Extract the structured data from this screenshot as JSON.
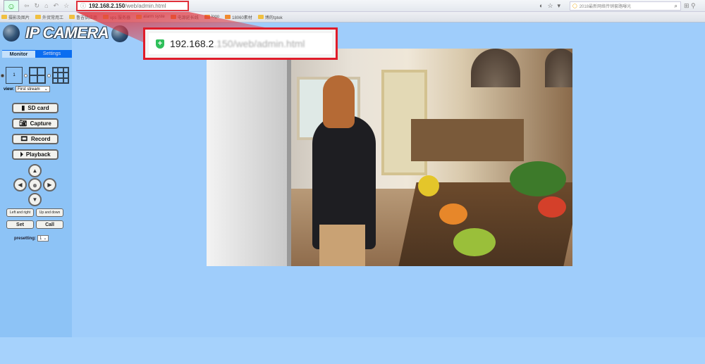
{
  "browser": {
    "url_host": "192.168.2.150",
    "url_path": "/web/admin.html",
    "search_placeholder": "2018最新网络传销套路曝光",
    "bookmarks": [
      {
        "label": "摄影及图片",
        "color": "#f0c040"
      },
      {
        "label": "外贸常用工",
        "color": "#f0c040"
      },
      {
        "label": "鲁吉供应商",
        "color": "#f0c040"
      },
      {
        "label": "vps 服务器",
        "color": "#f0c040"
      },
      {
        "label": "alarm syste",
        "color": "#f0c040"
      },
      {
        "label": "电源延长线",
        "color": "#f08a30"
      },
      {
        "label": "logo",
        "color": "#f08a30"
      },
      {
        "label": "18060素材",
        "color": "#f08a30"
      },
      {
        "label": "博的tptek",
        "color": "#f0c040"
      }
    ]
  },
  "callout": {
    "url_visible": "192.168.2",
    "url_blurred": ".150/web/admin.html",
    "border_color": "#e01c2a"
  },
  "app": {
    "logo_text": "IP CAMERA",
    "tabs": [
      {
        "label": "Monitor",
        "active": true
      },
      {
        "label": "Settings",
        "active": false
      }
    ],
    "layout_single_label": "1",
    "view_label": "view:",
    "view_value": "First stream",
    "buttons": {
      "sd_card": "SD card",
      "capture": "Capture",
      "record": "Record",
      "playback": "Playback"
    },
    "ptz": {
      "left_right": "Left and right",
      "up_down": "Up and down",
      "set": "Set",
      "call": "Call"
    },
    "presetting_label": "presetting:",
    "presetting_value": "1"
  }
}
